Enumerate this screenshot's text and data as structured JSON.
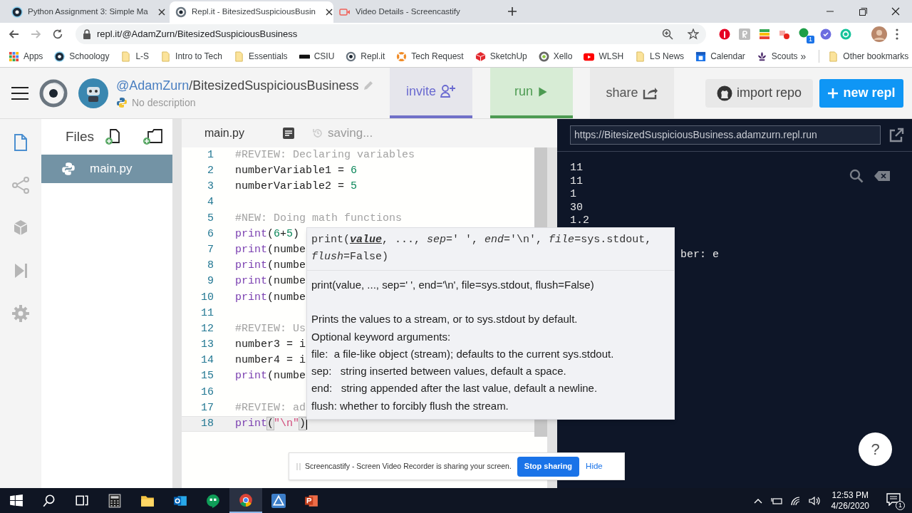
{
  "browser": {
    "tabs": [
      {
        "title": "Python Assignment 3: Simple Ma",
        "kind": "circle",
        "selected": false
      },
      {
        "title": "Repl.it - BitesizedSuspiciousBusin",
        "kind": "spiral",
        "selected": true
      },
      {
        "title": "Video Details - Screencastify",
        "kind": "video",
        "selected": false
      }
    ],
    "url": "repl.it/@AdamZurn/BitesizedSuspiciousBusiness",
    "extension_badge": "1",
    "bookmarks": [
      {
        "label": "Apps",
        "kind": "grid"
      },
      {
        "label": "Schoology",
        "kind": "circle"
      },
      {
        "label": "L-S",
        "kind": "folder"
      },
      {
        "label": "Intro to Tech",
        "kind": "folder"
      },
      {
        "label": "Essentials",
        "kind": "folder"
      },
      {
        "label": "CSIU",
        "kind": "bar"
      },
      {
        "label": "Repl.it",
        "kind": "spiral"
      },
      {
        "label": "Tech Request",
        "kind": "lifebuoy"
      },
      {
        "label": "SketchUp",
        "kind": "cube"
      },
      {
        "label": "Xello",
        "kind": "ring"
      },
      {
        "label": "WLSH",
        "kind": "play"
      },
      {
        "label": "LS News",
        "kind": "folder"
      },
      {
        "label": "Calendar",
        "kind": "calendar"
      },
      {
        "label": "Scouts",
        "kind": "fleur"
      }
    ],
    "more": "»",
    "other_bookmarks": "Other bookmarks"
  },
  "repl": {
    "owner": "@AdamZurn",
    "name": "/BitesizedSuspiciousBusiness",
    "description": "No description",
    "buttons": [
      {
        "label": "invite",
        "kind": "invite"
      },
      {
        "label": "run",
        "kind": "run"
      },
      {
        "label": "share",
        "kind": "share"
      },
      {
        "label": "import repo",
        "kind": "import"
      },
      {
        "label": "new repl",
        "kind": "new"
      }
    ]
  },
  "rail": [
    {
      "kind": "file",
      "selected": true
    },
    {
      "kind": "nodes",
      "selected": false
    },
    {
      "kind": "cube",
      "selected": false
    },
    {
      "kind": "skip",
      "selected": false
    },
    {
      "kind": "gear",
      "selected": false
    }
  ],
  "files": {
    "title": "Files",
    "items": [
      {
        "name": "main.py",
        "selected": true
      }
    ]
  },
  "editor": {
    "tab": "main.py",
    "status": "saving...",
    "lines": [
      {
        "number": "1",
        "active": false,
        "tokens": [
          {
            "kind": "comment",
            "text": "#REVIEW: Declaring variables"
          }
        ]
      },
      {
        "number": "2",
        "active": false,
        "tokens": [
          {
            "kind": "plain",
            "text": "numberVariable1 = "
          },
          {
            "kind": "number",
            "text": "6"
          }
        ]
      },
      {
        "number": "3",
        "active": false,
        "tokens": [
          {
            "kind": "plain",
            "text": "numberVariable2 = "
          },
          {
            "kind": "number",
            "text": "5"
          }
        ]
      },
      {
        "number": "4",
        "active": false
      },
      {
        "number": "5",
        "active": false,
        "tokens": [
          {
            "kind": "comment",
            "text": "#NEW: Doing math functions"
          }
        ]
      },
      {
        "number": "6",
        "active": false,
        "tokens": [
          {
            "kind": "keyword",
            "text": "print"
          },
          {
            "kind": "plain",
            "text": "("
          },
          {
            "kind": "number",
            "text": "6"
          },
          {
            "kind": "plain",
            "text": "+"
          },
          {
            "kind": "number",
            "text": "5"
          },
          {
            "kind": "plain",
            "text": ")"
          }
        ]
      },
      {
        "number": "7",
        "active": false,
        "tokens": [
          {
            "kind": "keyword",
            "text": "print"
          },
          {
            "kind": "plain",
            "text": "(numbe"
          }
        ]
      },
      {
        "number": "8",
        "active": false,
        "tokens": [
          {
            "kind": "keyword",
            "text": "print"
          },
          {
            "kind": "plain",
            "text": "(numbe"
          }
        ]
      },
      {
        "number": "9",
        "active": false,
        "tokens": [
          {
            "kind": "keyword",
            "text": "print"
          },
          {
            "kind": "plain",
            "text": "(numbe"
          }
        ]
      },
      {
        "number": "10",
        "active": false,
        "tokens": [
          {
            "kind": "keyword",
            "text": "print"
          },
          {
            "kind": "plain",
            "text": "(numbe"
          }
        ]
      },
      {
        "number": "11",
        "active": false
      },
      {
        "number": "12",
        "active": false,
        "tokens": [
          {
            "kind": "comment",
            "text": "#REVIEW: Us"
          }
        ]
      },
      {
        "number": "13",
        "active": false,
        "tokens": [
          {
            "kind": "plain",
            "text": "number3 = i"
          }
        ]
      },
      {
        "number": "14",
        "active": false,
        "tokens": [
          {
            "kind": "plain",
            "text": "number4 = i"
          }
        ]
      },
      {
        "number": "15",
        "active": false,
        "tokens": [
          {
            "kind": "keyword",
            "text": "print"
          },
          {
            "kind": "plain",
            "text": "(numbe"
          }
        ]
      },
      {
        "number": "16",
        "active": false
      },
      {
        "number": "17",
        "active": false,
        "tokens": [
          {
            "kind": "comment",
            "text": "#REVIEW: ad"
          }
        ]
      },
      {
        "number": "18",
        "active": true,
        "tokens": [
          {
            "kind": "keyword",
            "text": "print"
          },
          {
            "kind": "bracket",
            "text": "("
          },
          {
            "kind": "string",
            "text": "\"\\n\""
          },
          {
            "kind": "bracket",
            "text": ")"
          }
        ]
      }
    ]
  },
  "tooltip": {
    "signature": [
      {
        "kind": "plain",
        "text": "print("
      },
      {
        "kind": "active_param",
        "text": "value"
      },
      {
        "kind": "plain",
        "text": ", ..., "
      },
      {
        "kind": "param",
        "text": "sep"
      },
      {
        "kind": "plain",
        "text": "=' ', "
      },
      {
        "kind": "param",
        "text": "end"
      },
      {
        "kind": "plain",
        "text": "='\\n', "
      },
      {
        "kind": "param",
        "text": "file"
      },
      {
        "kind": "plain",
        "text": "=sys.stdout, "
      },
      {
        "kind": "param",
        "text": "flush"
      },
      {
        "kind": "plain",
        "text": "=False)"
      }
    ],
    "doc_signature": "print(value, ..., sep=' ', end='\\n', file=sys.stdout, flush=False)",
    "doc": [
      "Prints the values to a stream, or to sys.stdout by default.",
      "Optional keyword arguments:",
      "file:  a file-like object (stream); defaults to the current sys.stdout.",
      "sep:   string inserted between values, default a space.",
      "end:   string appended after the last value, default a newline.",
      "flush: whether to forcibly flush the stream."
    ]
  },
  "console": {
    "url": "https://BitesizedSuspiciousBusiness.adamzurn.repl.run",
    "output": [
      "11",
      "11",
      "1",
      "30",
      "1.2"
    ],
    "partial_line": "ber: e"
  },
  "help": "?",
  "screencastify": {
    "message": "Screencastify - Screen Video Recorder is sharing your screen.",
    "stop": "Stop sharing",
    "hide": "Hide"
  },
  "taskbar": {
    "apps": [
      {
        "kind": "windows",
        "selected": false
      },
      {
        "kind": "search",
        "selected": false
      },
      {
        "kind": "taskview",
        "selected": false
      },
      {
        "kind": "calculator",
        "selected": false
      },
      {
        "kind": "folder",
        "selected": false
      },
      {
        "kind": "mail",
        "selected": false
      },
      {
        "kind": "chat",
        "selected": false
      },
      {
        "kind": "browser",
        "selected": true
      },
      {
        "kind": "triangle",
        "selected": false
      },
      {
        "kind": "slides",
        "selected": false
      }
    ],
    "time": "12:53 PM",
    "date": "4/26/2020",
    "notifications": "1"
  }
}
